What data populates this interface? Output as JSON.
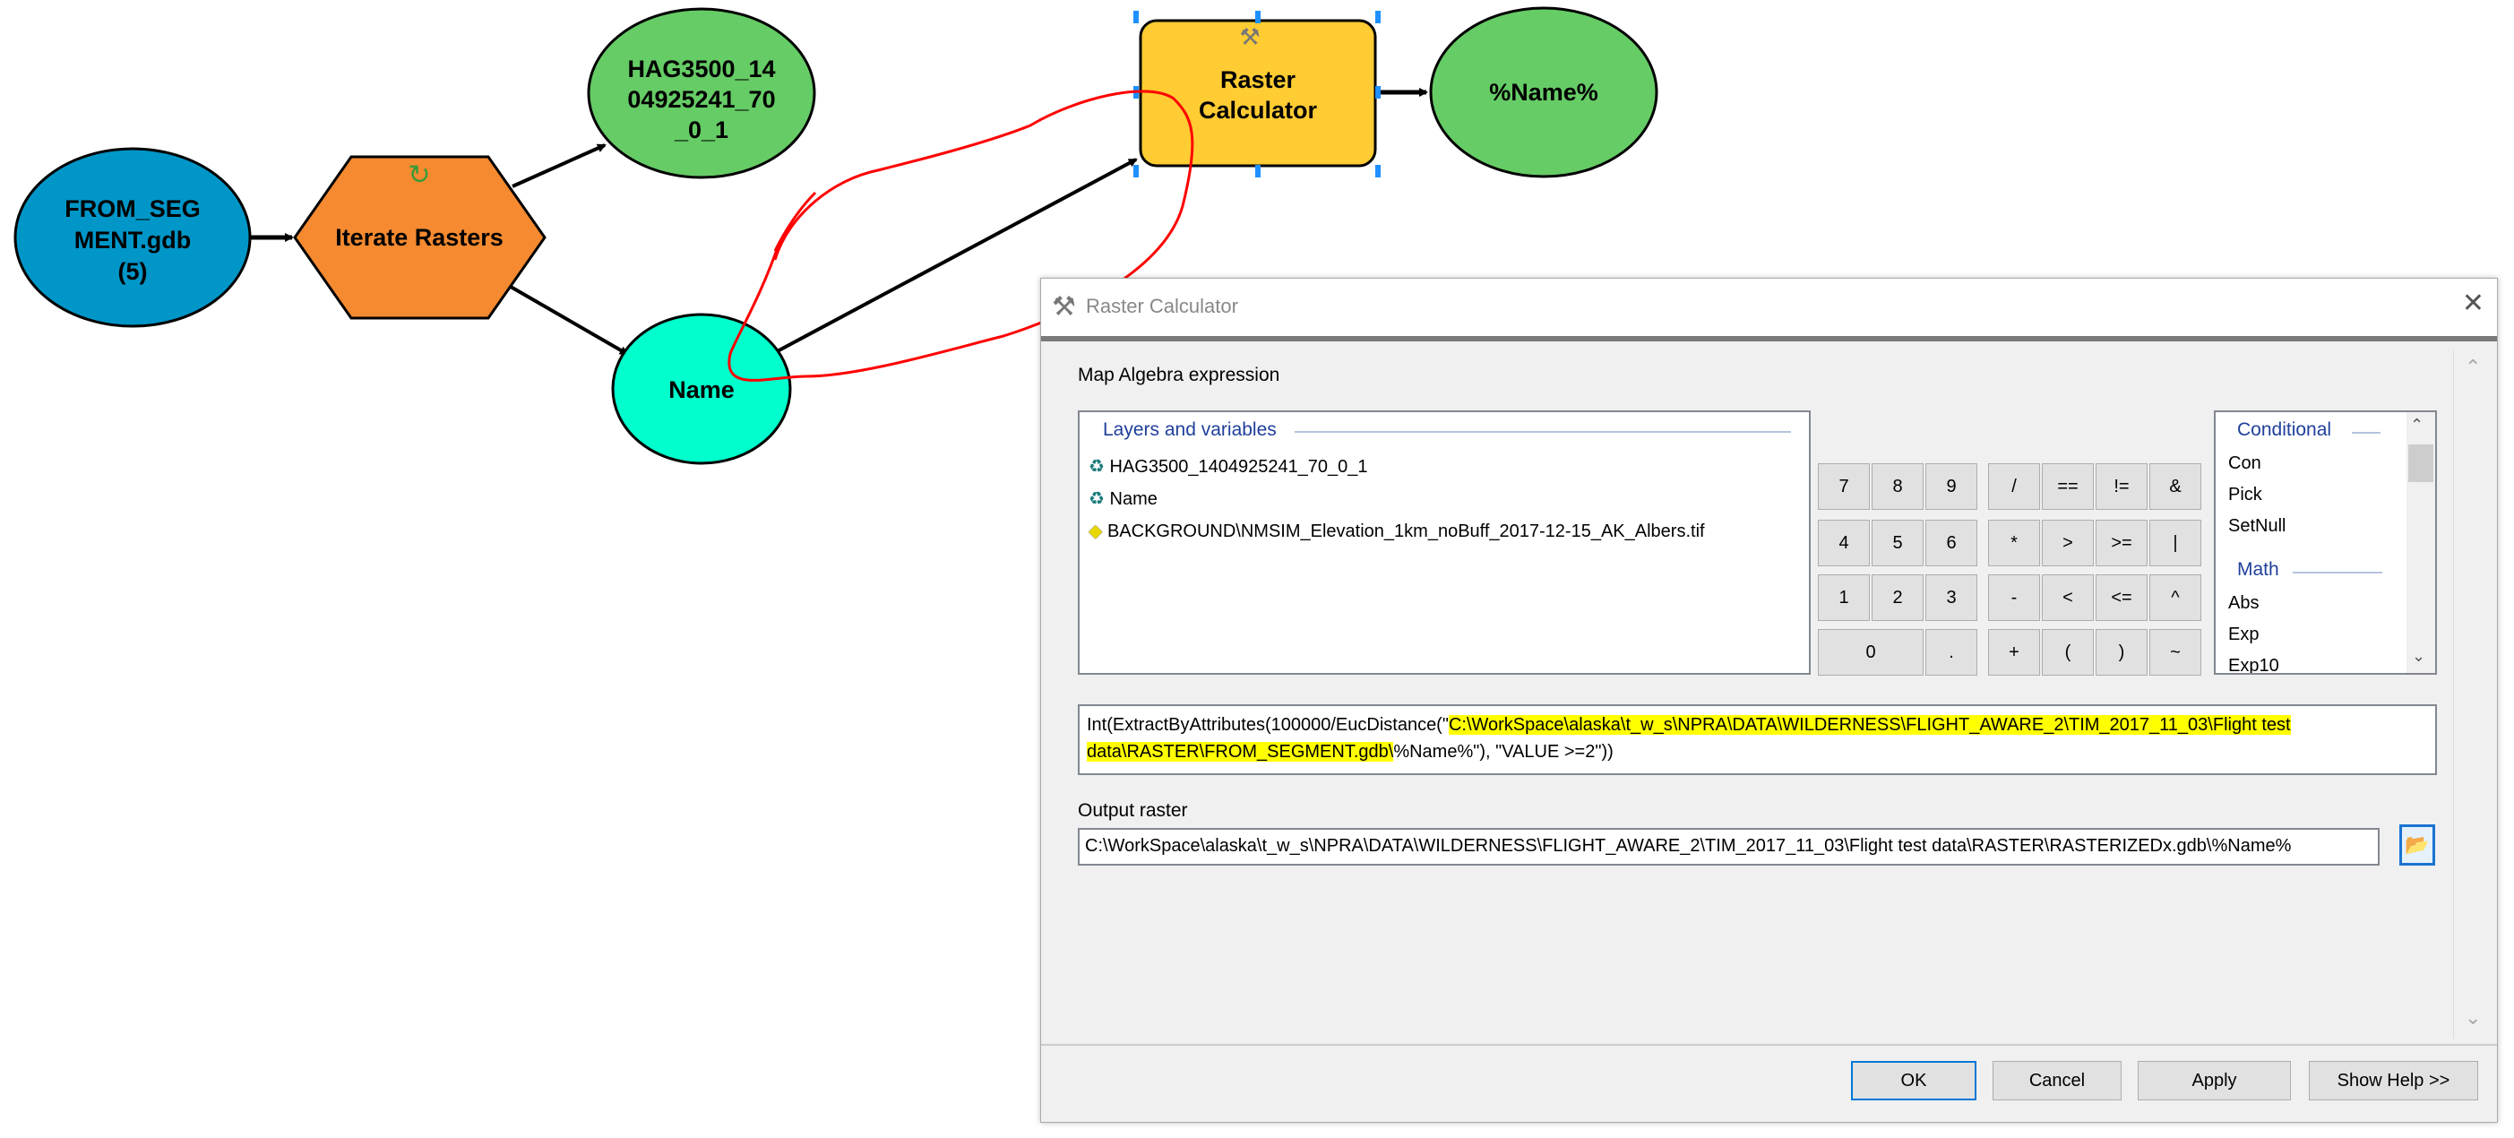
{
  "diagram": {
    "nodes": {
      "input_dataset": {
        "lines": [
          "FROM_SEG",
          "MENT.gdb",
          "(5)"
        ],
        "color": "#0096c8"
      },
      "iterator": {
        "label": "Iterate Rasters",
        "color": "#f58a30",
        "icon": "refresh-icon"
      },
      "raster_output": {
        "lines": [
          "HAG3500_14",
          "04925241_70",
          "_0_1"
        ],
        "color": "#66cc66"
      },
      "name_variable": {
        "label": "Name",
        "color": "#00ffcc"
      },
      "tool": {
        "lines": [
          "Raster",
          "Calculator"
        ],
        "color": "#ffcc33",
        "icon": "hammer-icon"
      },
      "tool_output": {
        "label": "%Name%",
        "color": "#66cc66"
      }
    },
    "annotation_color": "#ff0000"
  },
  "dialog": {
    "title": "Raster Calculator",
    "title_icon": "hammer-icon",
    "map_algebra_label": "Map Algebra expression",
    "layers": {
      "header": "Layers and variables",
      "items": [
        {
          "icon": "variable-icon",
          "label": "HAG3500_1404925241_70_0_1"
        },
        {
          "icon": "variable-icon",
          "label": "Name"
        },
        {
          "icon": "raster-layer-icon",
          "label": "BACKGROUND\\NMSIM_Elevation_1km_noBuff_2017-12-15_AK_Albers.tif"
        }
      ]
    },
    "keypad": [
      [
        "7",
        "8",
        "9",
        "/",
        "==",
        "!=",
        "&"
      ],
      [
        "4",
        "5",
        "6",
        "*",
        ">",
        ">=",
        "|"
      ],
      [
        "1",
        "2",
        "3",
        "-",
        "<",
        "<=",
        "^"
      ],
      [
        "0",
        ".",
        "+",
        "(",
        ")",
        "~"
      ]
    ],
    "functions": {
      "groups": [
        {
          "header": "Conditional",
          "items": [
            "Con",
            "Pick",
            "SetNull"
          ]
        },
        {
          "header": "Math",
          "items": [
            "Abs",
            "Exp",
            "Exp10"
          ]
        }
      ]
    },
    "expression": {
      "prefix": "Int(ExtractByAttributes(100000/EucDistance(\"",
      "highlighted_line1": "C:\\WorkSpace\\alaska\\t_w_s\\NPRA\\DATA\\WILDERNESS\\FLIGHT_AWARE_2\\TIM_2017_11_03\\Flight test",
      "highlighted_line2": "data\\RASTER\\FROM_SEGMENT.gdb\\",
      "suffix": "%Name%\"), \"VALUE >=2\"))",
      "highlight_color": "#ffff00"
    },
    "output_raster": {
      "label": "Output raster",
      "value": "C:\\WorkSpace\\alaska\\t_w_s\\NPRA\\DATA\\WILDERNESS\\FLIGHT_AWARE_2\\TIM_2017_11_03\\Flight test data\\RASTER\\RASTERIZEDx.gdb\\%Name%"
    },
    "buttons": {
      "ok": "OK",
      "cancel": "Cancel",
      "apply": "Apply",
      "help": "Show Help >>"
    }
  }
}
